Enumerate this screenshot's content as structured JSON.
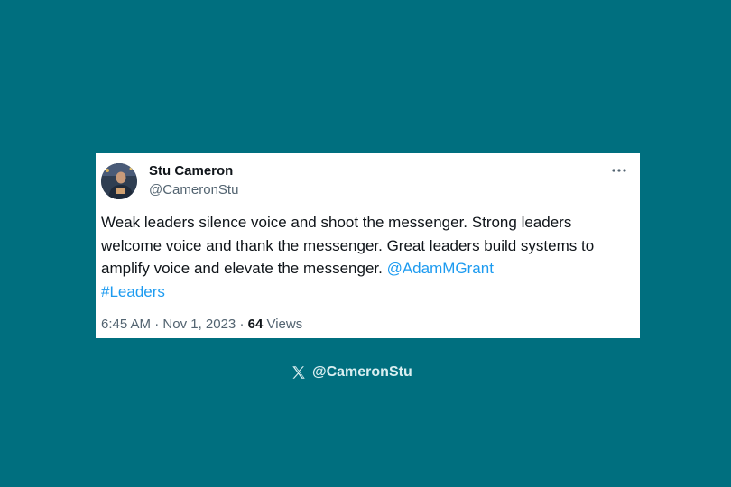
{
  "tweet": {
    "author_name": "Stu Cameron",
    "author_handle": "@CameronStu",
    "text_part1": "Weak leaders silence voice and shoot the messenger. Strong leaders welcome voice and thank the messenger. Great leaders build systems to amplify voice and elevate the messenger. ",
    "mention": "@AdamMGrant",
    "hashtag": "#Leaders",
    "time": "6:45 AM",
    "separator": "·",
    "date": "Nov 1, 2023",
    "views_count": "64",
    "views_label": "Views",
    "more_icon": "more-horizontal-icon"
  },
  "watermark": {
    "icon": "x-logo-icon",
    "handle": "@CameronStu"
  },
  "colors": {
    "background": "#006f7f",
    "card": "#ffffff",
    "link": "#1d9bf0",
    "text": "#0f1419",
    "muted": "#536471"
  }
}
